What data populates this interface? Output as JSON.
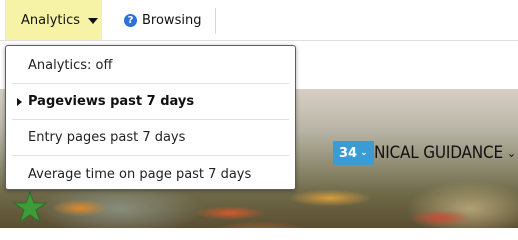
{
  "toolbar": {
    "analytics_label": "Analytics",
    "browsing_label": "Browsing",
    "help_glyph": "?"
  },
  "menu": {
    "items": [
      {
        "label": "Analytics: off",
        "active": false
      },
      {
        "label": "Pageviews past 7 days",
        "active": true
      },
      {
        "label": "Entry pages past 7 days",
        "active": false
      },
      {
        "label": "Average time on page past 7 days",
        "active": false
      }
    ]
  },
  "page": {
    "badge_count": "34",
    "heading_visible": "NICAL GUIDANCE"
  },
  "colors": {
    "analytics_highlight": "#f7f3a6",
    "badge": "#3a9bd5",
    "help_icon": "#2b71d8"
  }
}
